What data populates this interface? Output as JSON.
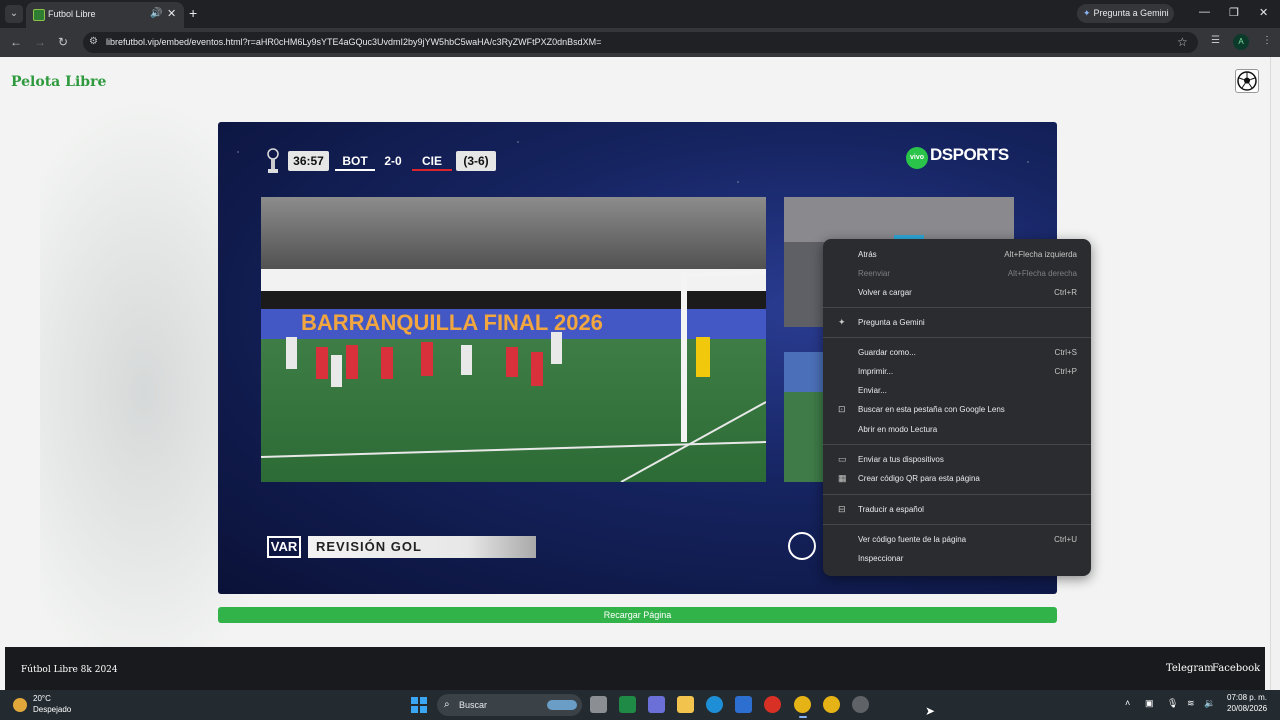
{
  "browser": {
    "tab": {
      "title": "Futbol Libre"
    },
    "new_tab": "+",
    "gemini_button": "Pregunta a Gemini",
    "url": "librefutbol.vip/embed/eventos.html?r=aHR0cHM6Ly9sYTE4aGQuc3UvdmI2by9jYW5hbC5waHA/c3RyZWFtPXZ0dnBsdXM=",
    "profile_initial": "A"
  },
  "page": {
    "brand": "Pelota Libre",
    "reload_button": "Recargar Página",
    "footer": {
      "copyright": "Fútbol Libre 8k 2024",
      "links": [
        "Telegram",
        "Facebook"
      ]
    }
  },
  "video": {
    "scorebug": {
      "time": "36:57",
      "home": "BOT",
      "score": "2-0",
      "away": "CIE",
      "aggregate": "(3-6)",
      "away_color": "#d9262e"
    },
    "broadcaster": {
      "badge": "vivo",
      "name": "DSPORTS"
    },
    "banner_text": "BARRANQUILLA FINAL 2026",
    "var_badge": "VAR",
    "var_label": "REVISIÓN GOL"
  },
  "context_menu": {
    "groups": [
      [
        {
          "label": "Atrás",
          "shortcut": "Alt+Flecha izquierda",
          "disabled": false
        },
        {
          "label": "Reenviar",
          "shortcut": "Alt+Flecha derecha",
          "disabled": true
        },
        {
          "label": "Volver a cargar",
          "shortcut": "Ctrl+R",
          "disabled": false
        }
      ],
      [
        {
          "label": "Pregunta a Gemini",
          "shortcut": "",
          "icon": "sparkle-icon"
        }
      ],
      [
        {
          "label": "Guardar como...",
          "shortcut": "Ctrl+S"
        },
        {
          "label": "Imprimir...",
          "shortcut": "Ctrl+P"
        },
        {
          "label": "Enviar...",
          "shortcut": ""
        },
        {
          "label": "Buscar en esta pestaña con Google Lens",
          "shortcut": "",
          "icon": "lens-icon"
        },
        {
          "label": "Abrir en modo Lectura",
          "shortcut": ""
        }
      ],
      [
        {
          "label": "Enviar a tus dispositivos",
          "shortcut": "",
          "icon": "devices-icon"
        },
        {
          "label": "Crear código QR para esta página",
          "shortcut": "",
          "icon": "qr-icon"
        }
      ],
      [
        {
          "label": "Traducir a español",
          "shortcut": "",
          "icon": "translate-icon"
        }
      ],
      [
        {
          "label": "Ver código fuente de la página",
          "shortcut": "Ctrl+U"
        },
        {
          "label": "Inspeccionar",
          "shortcut": ""
        }
      ]
    ]
  },
  "taskbar": {
    "weather": {
      "temp": "20°C",
      "desc": "Despejado"
    },
    "search_placeholder": "Buscar",
    "clock": {
      "time": "07:08 p. m.",
      "date": "20/08/2026"
    }
  }
}
